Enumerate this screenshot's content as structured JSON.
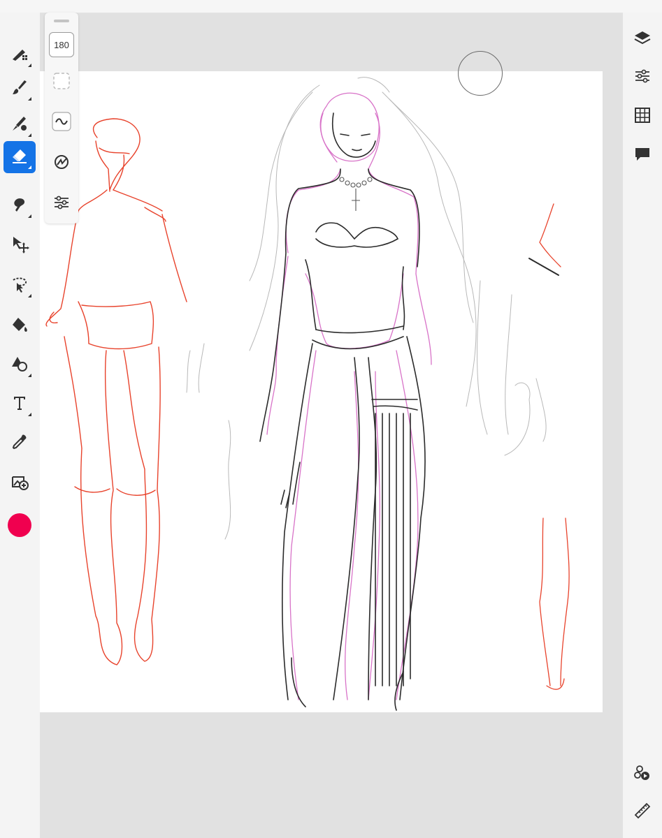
{
  "app": {
    "accent_color": "#1473e6",
    "current_color": "#f0004f"
  },
  "left_toolbar": {
    "tools": [
      {
        "name": "pixel-brush",
        "icon": "pixel-brush-icon",
        "active": false
      },
      {
        "name": "live-brush",
        "icon": "live-brush-icon",
        "active": false
      },
      {
        "name": "vector-brush",
        "icon": "vector-brush-icon",
        "active": false
      },
      {
        "name": "eraser",
        "icon": "eraser-icon",
        "active": true
      },
      {
        "name": "smudge",
        "icon": "smudge-icon",
        "active": false
      },
      {
        "name": "transform",
        "icon": "move-icon",
        "active": false
      },
      {
        "name": "selection",
        "icon": "lasso-icon",
        "active": false
      },
      {
        "name": "fill",
        "icon": "paint-bucket-icon",
        "active": false
      },
      {
        "name": "shapes",
        "icon": "shapes-icon",
        "active": false
      },
      {
        "name": "type",
        "icon": "type-icon",
        "active": false
      },
      {
        "name": "eyedropper",
        "icon": "eyedropper-icon",
        "active": false
      },
      {
        "name": "place-image",
        "icon": "add-image-icon",
        "active": false
      }
    ]
  },
  "tool_options": {
    "brush_size": "180",
    "buttons": [
      {
        "name": "brush-shape",
        "icon": "square-dashed-icon"
      },
      {
        "name": "brush-flow",
        "icon": "wave-icon"
      },
      {
        "name": "smoothing",
        "icon": "smoothing-icon"
      },
      {
        "name": "brush-settings",
        "icon": "sliders-icon"
      }
    ]
  },
  "right_panel": {
    "buttons": [
      {
        "name": "layers",
        "icon": "layers-icon"
      },
      {
        "name": "properties",
        "icon": "sliders-icon"
      },
      {
        "name": "grid",
        "icon": "grid-icon"
      },
      {
        "name": "comments",
        "icon": "speech-bubble-icon"
      },
      {
        "name": "timelapse",
        "icon": "timelapse-icon"
      },
      {
        "name": "ruler",
        "icon": "ruler-icon"
      }
    ]
  }
}
